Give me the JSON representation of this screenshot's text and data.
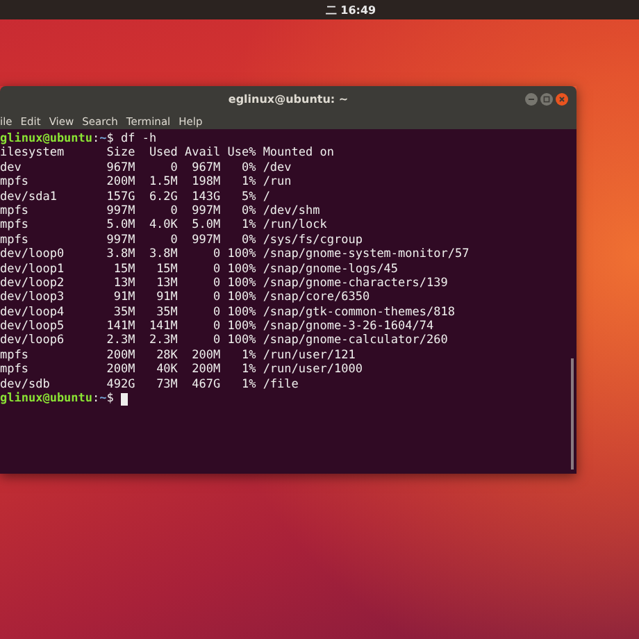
{
  "top_bar": {
    "clock": "二 16:49"
  },
  "window": {
    "title": "eglinux@ubuntu: ~",
    "menu": [
      "ile",
      "Edit",
      "View",
      "Search",
      "Terminal",
      "Help"
    ],
    "terminal": {
      "lines": [
        {
          "kind": "prompt",
          "user_host": "glinux@ubuntu",
          "separator": ":",
          "path": "~",
          "command": "$ df -h",
          "cursor": false
        },
        {
          "kind": "header",
          "cells": [
            "ilesystem",
            "Size",
            "Used",
            "Avail",
            "Use%",
            "Mounted on"
          ]
        },
        {
          "kind": "row",
          "cells": [
            "dev",
            "967M",
            "0",
            "967M",
            "0%",
            "/dev"
          ]
        },
        {
          "kind": "row",
          "cells": [
            "mpfs",
            "200M",
            "1.5M",
            "198M",
            "1%",
            "/run"
          ]
        },
        {
          "kind": "row",
          "cells": [
            "dev/sda1",
            "157G",
            "6.2G",
            "143G",
            "5%",
            "/"
          ]
        },
        {
          "kind": "row",
          "cells": [
            "mpfs",
            "997M",
            "0",
            "997M",
            "0%",
            "/dev/shm"
          ]
        },
        {
          "kind": "row",
          "cells": [
            "mpfs",
            "5.0M",
            "4.0K",
            "5.0M",
            "1%",
            "/run/lock"
          ]
        },
        {
          "kind": "row",
          "cells": [
            "mpfs",
            "997M",
            "0",
            "997M",
            "0%",
            "/sys/fs/cgroup"
          ]
        },
        {
          "kind": "row",
          "cells": [
            "dev/loop0",
            "3.8M",
            "3.8M",
            "0",
            "100%",
            "/snap/gnome-system-monitor/57"
          ]
        },
        {
          "kind": "row",
          "cells": [
            "dev/loop1",
            "15M",
            "15M",
            "0",
            "100%",
            "/snap/gnome-logs/45"
          ]
        },
        {
          "kind": "row",
          "cells": [
            "dev/loop2",
            "13M",
            "13M",
            "0",
            "100%",
            "/snap/gnome-characters/139"
          ]
        },
        {
          "kind": "row",
          "cells": [
            "dev/loop3",
            "91M",
            "91M",
            "0",
            "100%",
            "/snap/core/6350"
          ]
        },
        {
          "kind": "row",
          "cells": [
            "dev/loop4",
            "35M",
            "35M",
            "0",
            "100%",
            "/snap/gtk-common-themes/818"
          ]
        },
        {
          "kind": "row",
          "cells": [
            "dev/loop5",
            "141M",
            "141M",
            "0",
            "100%",
            "/snap/gnome-3-26-1604/74"
          ]
        },
        {
          "kind": "row",
          "cells": [
            "dev/loop6",
            "2.3M",
            "2.3M",
            "0",
            "100%",
            "/snap/gnome-calculator/260"
          ]
        },
        {
          "kind": "row",
          "cells": [
            "mpfs",
            "200M",
            "28K",
            "200M",
            "1%",
            "/run/user/121"
          ]
        },
        {
          "kind": "row",
          "cells": [
            "mpfs",
            "200M",
            "40K",
            "200M",
            "1%",
            "/run/user/1000"
          ]
        },
        {
          "kind": "row",
          "cells": [
            "dev/sdb",
            "492G",
            "73M",
            "467G",
            "1%",
            "/file"
          ]
        },
        {
          "kind": "prompt",
          "user_host": "glinux@ubuntu",
          "separator": ":",
          "path": "~",
          "command": "$",
          "cursor": true
        }
      ]
    }
  }
}
